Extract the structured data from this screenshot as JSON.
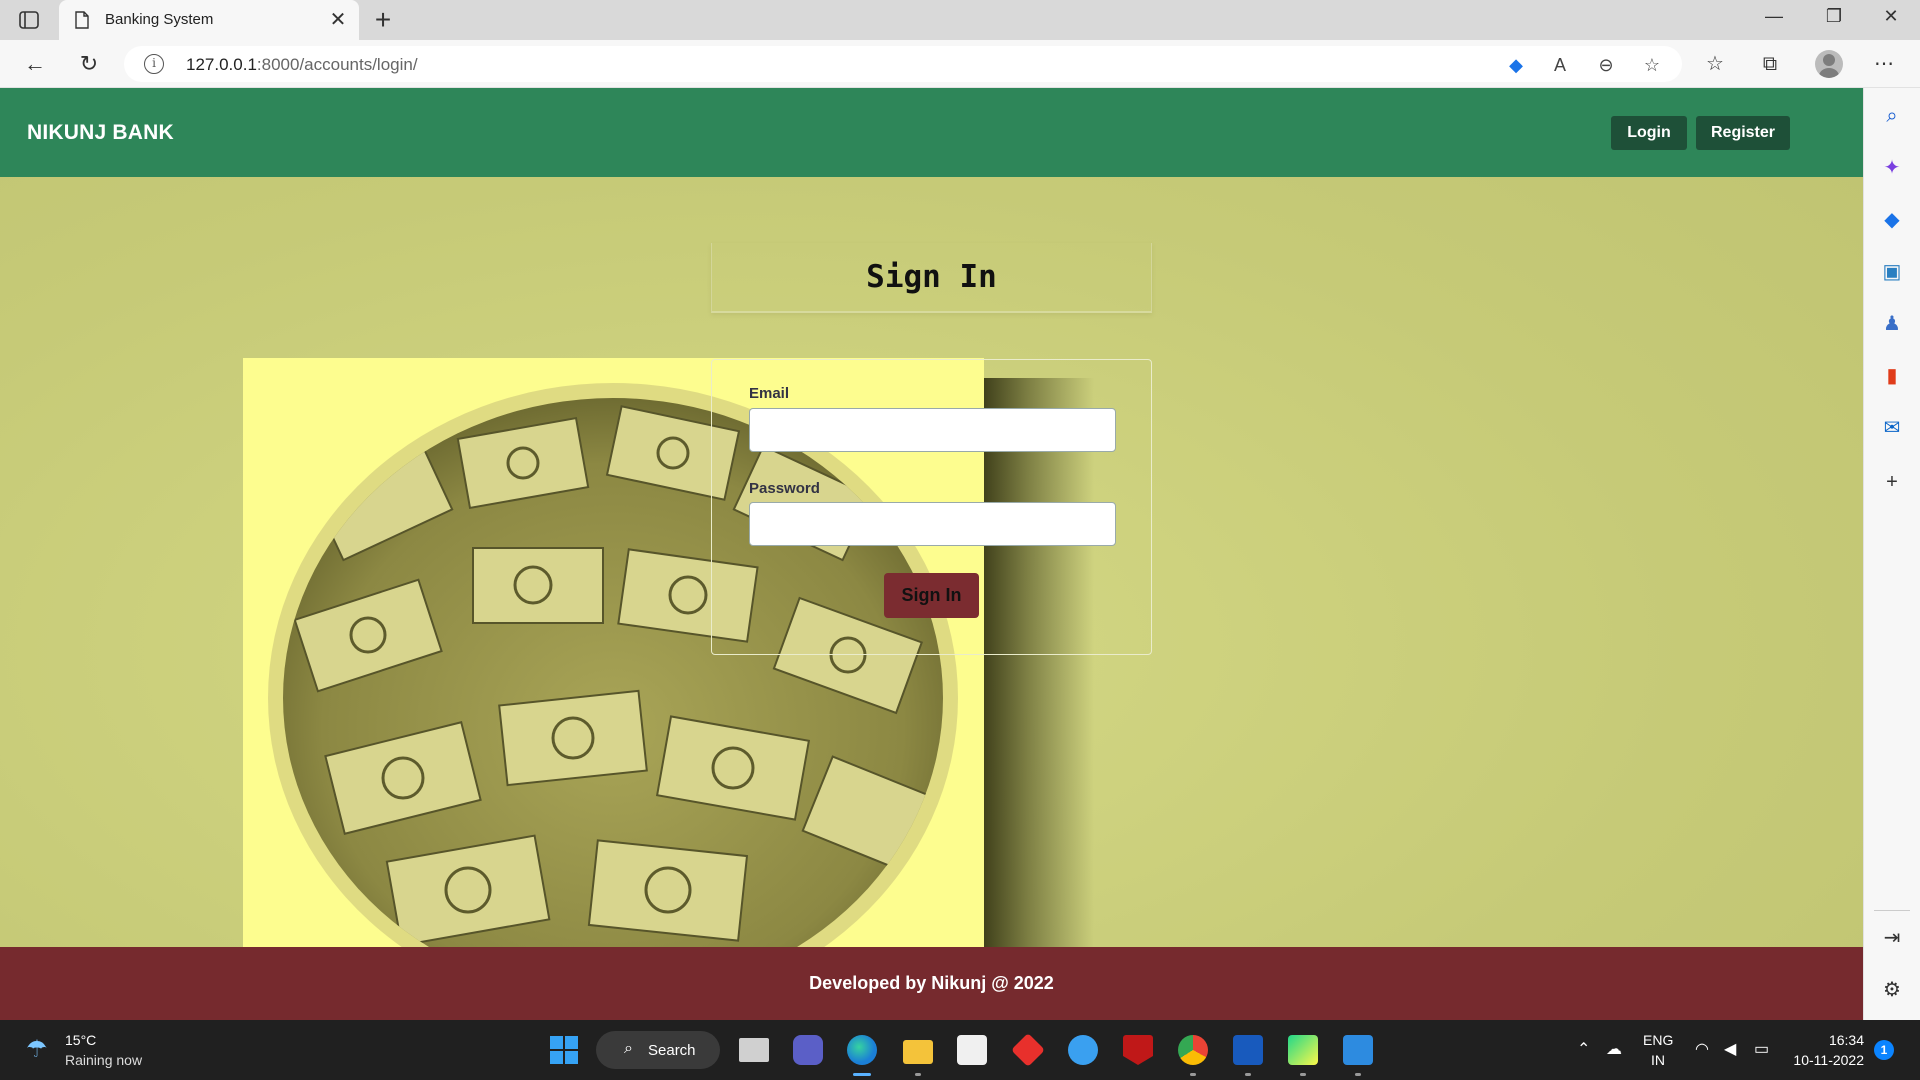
{
  "browser": {
    "tab_title": "Banking System",
    "url_host": "127.0.0.1",
    "url_path": ":8000/accounts/login/"
  },
  "site": {
    "brand": "NIKUNJ BANK",
    "nav": {
      "login": "Login",
      "register": "Register"
    }
  },
  "signin": {
    "title": "Sign In",
    "email_label": "Email",
    "email_value": "",
    "password_label": "Password",
    "password_value": "",
    "submit_label": "Sign In"
  },
  "footer": {
    "text": "Developed by Nikunj @ 2022"
  },
  "taskbar": {
    "weather_temp": "15°C",
    "weather_desc": "Raining now",
    "search_label": "Search",
    "lang_top": "ENG",
    "lang_bottom": "IN",
    "time": "16:34",
    "date": "10-11-2022",
    "notification_count": "1"
  },
  "colors": {
    "navbar": "#2e8659",
    "nav_button": "#1e5038",
    "page_bg": "#c5c97a",
    "signin_button": "#7b2c30",
    "footer": "#762a2e"
  }
}
